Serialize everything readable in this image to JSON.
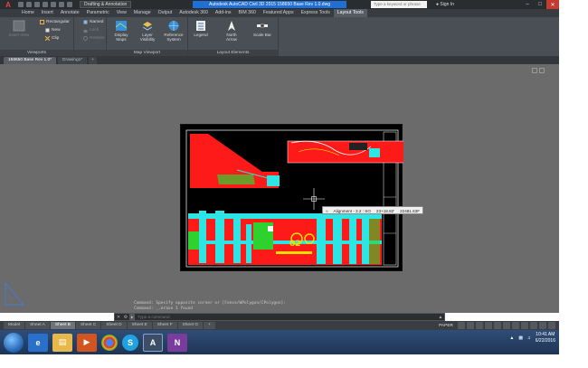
{
  "titlebar": {
    "workspace": "Drafting & Annotation",
    "title": "Autodesk AutoCAD Civil 3D 2015  158650 Base Rev 1.0.dwg",
    "search_placeholder": "Type a keyword or phrase",
    "sign_in": "Sign In",
    "app_logo": "autocad-a-icon"
  },
  "ribbon_tabs": [
    "Home",
    "Insert",
    "Annotate",
    "Parametric",
    "View",
    "Manage",
    "Output",
    "Autodesk 360",
    "Add-ins",
    "BIM 360",
    "Featured Apps",
    "Express Tools",
    "Layout Tools"
  ],
  "active_ribbon_tab": "Layout Tools",
  "ribbon": {
    "viewports": {
      "label": "Viewports",
      "big_button": "Insert View",
      "rectangular": "Rectangular",
      "new": "New",
      "clip": "Clip",
      "named": "Named",
      "lock": "Lock",
      "restore": "Restore"
    },
    "map_viewport": {
      "label": "Map Viewport",
      "display_maps": "Display Maps",
      "layer_visibility": "Layer Visibility",
      "reference_system": "Reference System"
    },
    "layout_elements": {
      "label": "Layout Elements",
      "legend": "Legend",
      "north_arrow": "North Arrow",
      "scale_bar": "Scale Bar"
    }
  },
  "document_tabs": [
    "158650 Base Rev 1.0*",
    "Drawing1*"
  ],
  "drawing": {
    "tooltip_name": "Alignment - 3.2 : SO",
    "tooltip_station": "23+18.82'",
    "tooltip_coord": "22481.63F"
  },
  "command": {
    "history_1": "Command: Specify opposite corner or [Fence/WPolygon/CPolygon]:",
    "history_2": "Command: _.erase 1 found",
    "placeholder": "Type a command"
  },
  "layout_tabs": [
    "Model",
    "Sheet A",
    "Sheet B",
    "Sheet C",
    "Sheet D",
    "Sheet E",
    "Sheet F",
    "Sheet G"
  ],
  "active_layout_tab": "Sheet B",
  "status": {
    "space": "PAPER"
  },
  "taskbar": {
    "time": "10:41 AM",
    "date": "6/22/2016",
    "apps": [
      "internet-explorer-icon",
      "file-explorer-icon",
      "media-player-icon",
      "chrome-icon",
      "skype-icon",
      "autocad-icon",
      "onenote-icon"
    ]
  },
  "colors": {
    "accent_blue": "#1e6fd6",
    "drawing_bg": "#6b6b6b",
    "red": "#ff1a1a",
    "cyan": "#2de5e5",
    "green": "#2fd12f",
    "yellow": "#f0e000"
  }
}
